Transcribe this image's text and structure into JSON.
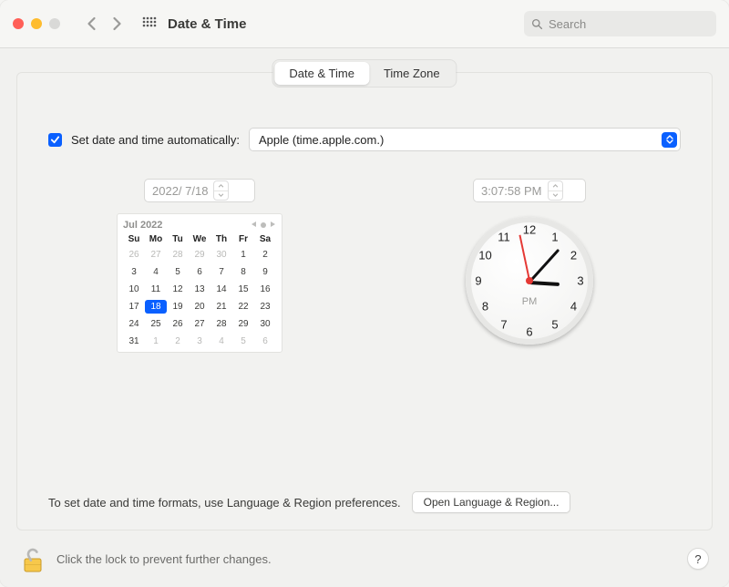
{
  "window": {
    "title": "Date & Time"
  },
  "search": {
    "placeholder": "Search"
  },
  "tabs": {
    "date_time": "Date & Time",
    "time_zone": "Time Zone",
    "active": 0
  },
  "auto": {
    "checked": true,
    "label": "Set date and time automatically:",
    "server": "Apple (time.apple.com.)"
  },
  "date_field": {
    "value": "2022/  7/18"
  },
  "time_field": {
    "value": "3:07:58 PM"
  },
  "calendar": {
    "month_label": "Jul 2022",
    "weekdays": [
      "Su",
      "Mo",
      "Tu",
      "We",
      "Th",
      "Fr",
      "Sa"
    ],
    "leading": [
      26,
      27,
      28,
      29,
      30
    ],
    "days": [
      1,
      2,
      3,
      4,
      5,
      6,
      7,
      8,
      9,
      10,
      11,
      12,
      13,
      14,
      15,
      16,
      17,
      18,
      19,
      20,
      21,
      22,
      23,
      24,
      25,
      26,
      27,
      28,
      29,
      30,
      31
    ],
    "trailing": [
      1,
      2,
      3,
      4,
      5,
      6
    ],
    "selected": 18
  },
  "clock": {
    "numbers": [
      "12",
      "1",
      "2",
      "3",
      "4",
      "5",
      "6",
      "7",
      "8",
      "9",
      "10",
      "11"
    ],
    "ampm": "PM",
    "hour": 3,
    "minute": 7,
    "second": 58
  },
  "hint": {
    "text": "To set date and time formats, use Language & Region preferences.",
    "button": "Open Language & Region..."
  },
  "footer": {
    "lock_text": "Click the lock to prevent further changes.",
    "help": "?"
  },
  "colors": {
    "accent": "#0a60ff",
    "traffic_close": "#ff5f57",
    "traffic_min": "#febc2e",
    "traffic_max": "#d9d9d7"
  }
}
